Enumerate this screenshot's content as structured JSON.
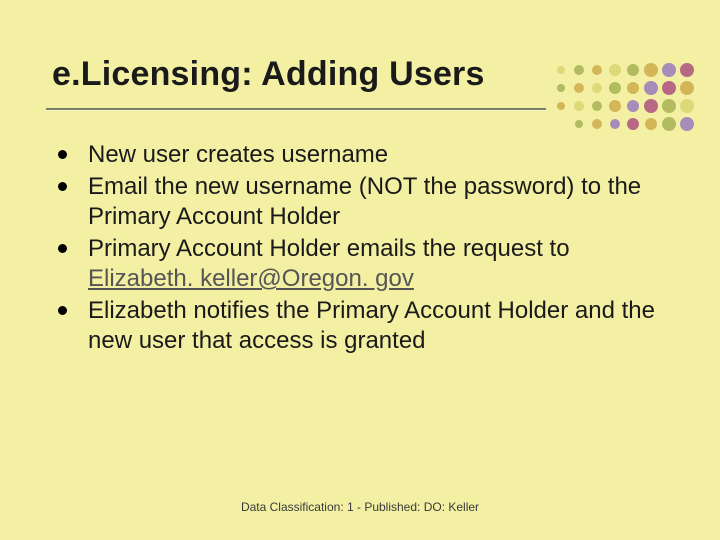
{
  "slide": {
    "title": "e.Licensing: Adding Users",
    "bullets": [
      {
        "text": "New user creates username"
      },
      {
        "text": "Email the new username (NOT the password) to the Primary Account Holder"
      },
      {
        "prefix": "Primary Account Holder emails the request to ",
        "link": "Elizabeth. keller@Oregon. gov"
      },
      {
        "text": "Elizabeth notifies the Primary Account Holder and the new user that access is granted"
      }
    ],
    "footer": "Data Classification: 1 - Published: DO: Keller"
  },
  "decor": {
    "colors": [
      "#d6d26b",
      "#9caa4a",
      "#c9a23f",
      "#8c6bbf",
      "#a33c7a"
    ]
  }
}
